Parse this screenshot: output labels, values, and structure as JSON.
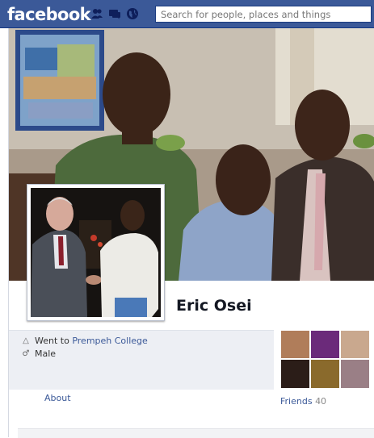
{
  "topbar": {
    "logo": "facebook",
    "search_placeholder": "Search for people, places and things",
    "icons": [
      "friend-requests-icon",
      "messages-icon",
      "notifications-globe-icon"
    ]
  },
  "profile": {
    "name": "Eric Osei",
    "education_prefix": "Went to",
    "education_school": "Prempeh College",
    "gender": "Male",
    "about_tab": "About",
    "friends_label": "Friends",
    "friends_count": "40"
  },
  "colors": {
    "brand_blue": "#3b5998",
    "info_bg": "#edeff4"
  }
}
